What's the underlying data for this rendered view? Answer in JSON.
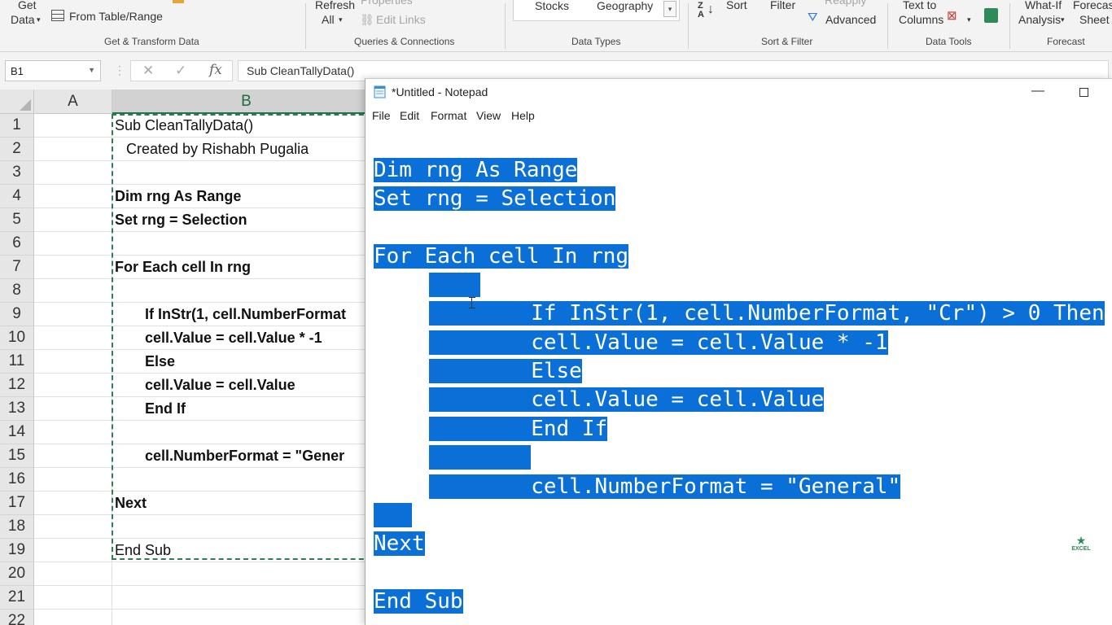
{
  "ribbon": {
    "get_data": "Get",
    "get_data_2": "Data",
    "from_table": "From Table/Range",
    "refresh": "Refresh",
    "refresh_all": "All",
    "properties": "Properties",
    "edit_links": "Edit Links",
    "stocks": "Stocks",
    "geography": "Geography",
    "sort": "Sort",
    "filter": "Filter",
    "reapply": "Reapply",
    "advanced": "Advanced",
    "text_to": "Text to",
    "columns": "Columns",
    "what_if": "What-If",
    "analysis": "Analysis",
    "forecast": "Forecast",
    "sheet": "Sheet",
    "groups": {
      "get_transform": "Get & Transform Data",
      "queries": "Queries & Connections",
      "data_types": "Data Types",
      "sort_filter": "Sort & Filter",
      "data_tools": "Data Tools",
      "forecast": "Forecast"
    }
  },
  "formula_bar": {
    "name_box": "B1",
    "fx": "fx",
    "formula": "Sub CleanTallyData()"
  },
  "sheet": {
    "columns": [
      "A",
      "B"
    ],
    "rows": [
      "1",
      "2",
      "3",
      "4",
      "5",
      "6",
      "7",
      "8",
      "9",
      "10",
      "11",
      "12",
      "13",
      "14",
      "15",
      "16",
      "17",
      "18",
      "19",
      "20",
      "21",
      "22"
    ],
    "cells": {
      "r1": "Sub CleanTallyData()",
      "r2": "Created by Rishabh Pugalia",
      "r4": "Dim rng As Range",
      "r5": "Set rng = Selection",
      "r7": "For Each cell In rng",
      "r9": "If InStr(1, cell.NumberFormat",
      "r10": "cell.Value = cell.Value * -1",
      "r11": "Else",
      "r12": "cell.Value = cell.Value",
      "r13": "End If",
      "r15": "cell.NumberFormat = \"Gener",
      "r17": "Next",
      "r19": "End Sub"
    }
  },
  "notepad": {
    "title": "*Untitled - Notepad",
    "minimize": "—",
    "menu": [
      "File",
      "Edit",
      "Format",
      "View",
      "Help"
    ],
    "lines": {
      "l1": "Dim rng As Range",
      "l2": "Set rng = Selection",
      "l3": "For Each cell In rng",
      "l4": "    ",
      "l5": "        If InStr(1, cell.NumberFormat, \"Cr\") > 0 Then",
      "l6": "        cell.Value = cell.Value * -1",
      "l7": "        Else",
      "l8": "        cell.Value = cell.Value",
      "l9": "        End If",
      "l10": "        ",
      "l11": "        cell.NumberFormat = \"General\"",
      "l12": "   ",
      "l13": "Next",
      "l14": "End Sub"
    },
    "logo_text": "EXCEL"
  },
  "colors": {
    "selection": "#0a6fd6",
    "marquee": "#2e7d57",
    "excel_green": "#217346"
  }
}
